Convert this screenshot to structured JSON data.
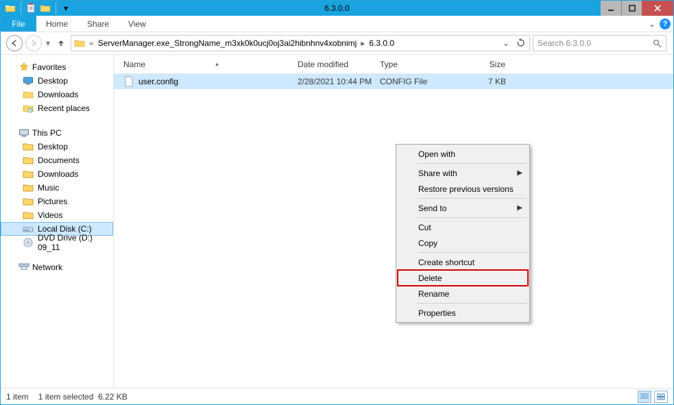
{
  "window": {
    "title": "6.3.0.0"
  },
  "ribbon": {
    "file": "File",
    "tabs": [
      "Home",
      "Share",
      "View"
    ]
  },
  "nav": {
    "breadcrumbs": [
      "ServerManager.exe_StrongName_m3xk0k0ucj0oj3ai2hibnhnv4xobnimj",
      "6.3.0.0"
    ],
    "leading_ellipsis": "«",
    "search_placeholder": "Search 6.3.0.0"
  },
  "sidebar": {
    "favorites": {
      "label": "Favorites",
      "items": [
        {
          "label": "Desktop",
          "icon": "desktop"
        },
        {
          "label": "Downloads",
          "icon": "folder"
        },
        {
          "label": "Recent places",
          "icon": "recent"
        }
      ]
    },
    "thispc": {
      "label": "This PC",
      "items": [
        {
          "label": "Desktop",
          "icon": "folder"
        },
        {
          "label": "Documents",
          "icon": "folder"
        },
        {
          "label": "Downloads",
          "icon": "folder"
        },
        {
          "label": "Music",
          "icon": "folder"
        },
        {
          "label": "Pictures",
          "icon": "folder"
        },
        {
          "label": "Videos",
          "icon": "folder"
        },
        {
          "label": "Local Disk (C:)",
          "icon": "drive",
          "selected": true
        },
        {
          "label": "DVD Drive (D:) 09_11",
          "icon": "dvd"
        }
      ]
    },
    "network": {
      "label": "Network"
    }
  },
  "columns": {
    "name": "Name",
    "date": "Date modified",
    "type": "Type",
    "size": "Size"
  },
  "files": [
    {
      "name": "user.config",
      "date": "2/28/2021 10:44 PM",
      "type": "CONFIG File",
      "size": "7 KB",
      "selected": true
    }
  ],
  "context_menu": {
    "open_with": "Open with",
    "share_with": "Share with",
    "restore": "Restore previous versions",
    "send_to": "Send to",
    "cut": "Cut",
    "copy": "Copy",
    "create_shortcut": "Create shortcut",
    "delete": "Delete",
    "rename": "Rename",
    "properties": "Properties"
  },
  "status": {
    "count": "1 item",
    "selected": "1 item selected",
    "size": "6.22 KB"
  }
}
